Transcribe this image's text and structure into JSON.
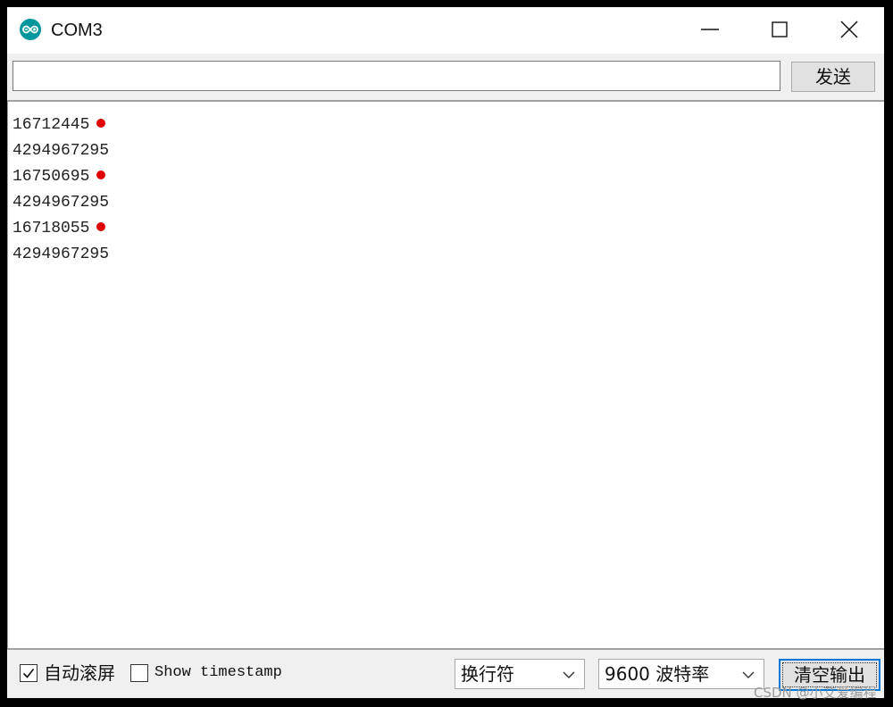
{
  "window": {
    "title": "COM3",
    "icon": "arduino-infinity-icon"
  },
  "send_row": {
    "input_value": "",
    "send_label": "发送"
  },
  "output": {
    "lines": [
      {
        "text": "16712445",
        "marked": true
      },
      {
        "text": "4294967295",
        "marked": false
      },
      {
        "text": "16750695",
        "marked": true
      },
      {
        "text": "4294967295",
        "marked": false
      },
      {
        "text": "16718055",
        "marked": true
      },
      {
        "text": "4294967295",
        "marked": false
      }
    ],
    "marker_color": "#e00000"
  },
  "bottom_bar": {
    "autoscroll_label": "自动滚屏",
    "autoscroll_checked": true,
    "timestamp_label": "Show timestamp",
    "timestamp_checked": false,
    "line_ending_value": "换行符",
    "baud_value": "9600 波特率",
    "clear_label": "清空输出"
  },
  "watermark": "CSDN @小艾爱编程",
  "colors": {
    "accent": "#0078d7",
    "app_icon": "#00979c"
  }
}
